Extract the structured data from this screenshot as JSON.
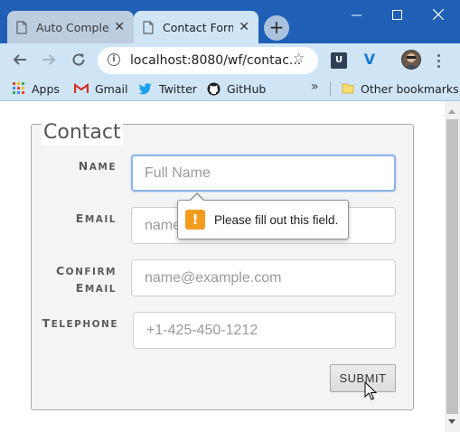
{
  "browser": {
    "tabs": [
      {
        "title": "Auto Complet",
        "active": false
      },
      {
        "title": "Contact Form",
        "active": true
      }
    ],
    "url": "localhost:8080/wf/contac...",
    "bookmarks": [
      {
        "label": "Apps",
        "icon": "apps-grid-icon"
      },
      {
        "label": "Gmail",
        "icon": "gmail-icon"
      },
      {
        "label": "Twitter",
        "icon": "twitter-icon"
      },
      {
        "label": "GitHub",
        "icon": "github-icon"
      }
    ],
    "other_bookmarks": "Other bookmarks",
    "overflow": "»",
    "colors": {
      "titlebar": "#1f5fb6",
      "toolbar": "#cfe5f6"
    }
  },
  "form": {
    "legend": "Contact",
    "fields": {
      "name": {
        "label": "Name",
        "placeholder": "Full Name"
      },
      "email": {
        "label": "Email",
        "placeholder": "name@example.com"
      },
      "confirm": {
        "label_line1": "Confirm",
        "label_line2": "Email",
        "placeholder": "name@example.com"
      },
      "telephone": {
        "label": "Telephone",
        "placeholder": "+1-425-450-1212"
      }
    },
    "submit_label": "SUBMIT",
    "validation_message": "Please fill out this field.",
    "warning_glyph": "!"
  }
}
